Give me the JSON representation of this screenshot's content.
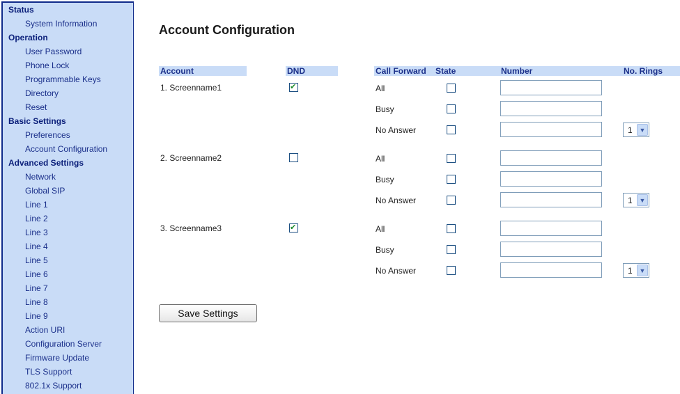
{
  "sidebar": {
    "sections": [
      {
        "title": "Status",
        "items": [
          "System Information"
        ]
      },
      {
        "title": "Operation",
        "items": [
          "User Password",
          "Phone Lock",
          "Programmable Keys",
          "Directory",
          "Reset"
        ]
      },
      {
        "title": "Basic Settings",
        "items": [
          "Preferences",
          "Account Configuration"
        ]
      },
      {
        "title": "Advanced Settings",
        "items": [
          "Network",
          "Global SIP",
          "Line 1",
          "Line 2",
          "Line 3",
          "Line 4",
          "Line 5",
          "Line 6",
          "Line 7",
          "Line 8",
          "Line 9",
          "Action URI",
          "Configuration Server",
          "Firmware Update",
          "TLS Support",
          "802.1x Support"
        ]
      }
    ]
  },
  "main": {
    "title": "Account Configuration",
    "headers": {
      "account": "Account",
      "dnd": "DND",
      "call_forward": "Call Forward",
      "state": "State",
      "number": "Number",
      "rings": "No. Rings"
    },
    "accounts": [
      {
        "name": "1. Screenname1",
        "dnd": true,
        "forwards": [
          {
            "type": "All",
            "state": false,
            "number": "",
            "rings": null
          },
          {
            "type": "Busy",
            "state": false,
            "number": "",
            "rings": null
          },
          {
            "type": "No Answer",
            "state": false,
            "number": "",
            "rings": "1"
          }
        ]
      },
      {
        "name": "2. Screenname2",
        "dnd": false,
        "forwards": [
          {
            "type": "All",
            "state": false,
            "number": "",
            "rings": null
          },
          {
            "type": "Busy",
            "state": false,
            "number": "",
            "rings": null
          },
          {
            "type": "No Answer",
            "state": false,
            "number": "",
            "rings": "1"
          }
        ]
      },
      {
        "name": "3. Screenname3",
        "dnd": true,
        "forwards": [
          {
            "type": "All",
            "state": false,
            "number": "",
            "rings": null
          },
          {
            "type": "Busy",
            "state": false,
            "number": "",
            "rings": null
          },
          {
            "type": "No Answer",
            "state": false,
            "number": "",
            "rings": "1"
          }
        ]
      }
    ],
    "save_label": "Save Settings"
  },
  "colors": {
    "sidebar_bg": "#c9dcf7",
    "sidebar_border": "#0f2a8a",
    "header_bg": "#c9dcf7",
    "link": "#1a2f8a",
    "check": "#1a8a2a"
  },
  "icons": {
    "checkmark": "check-icon",
    "dropdown": "chevron-down-icon"
  }
}
